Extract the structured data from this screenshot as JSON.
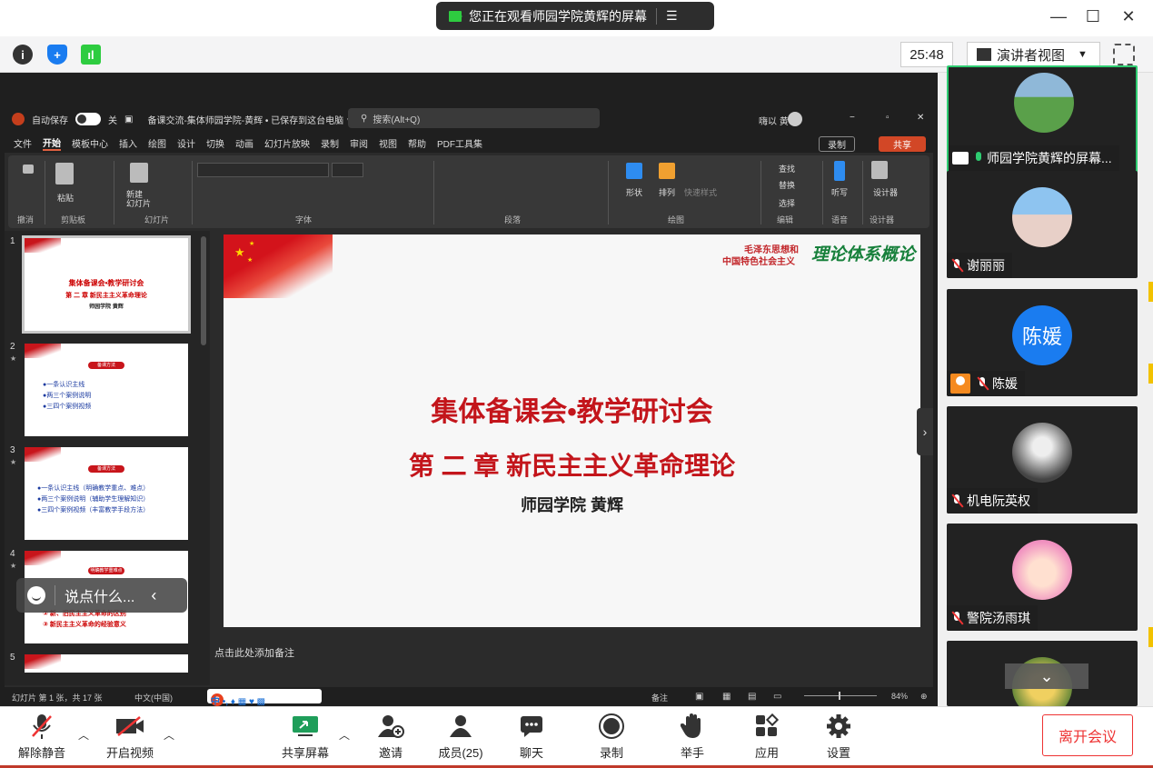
{
  "banner": {
    "text": "您正在观看师园学院黄辉的屏幕"
  },
  "window": {
    "minimize": "—",
    "maximize": "☐",
    "close": "✕"
  },
  "toolbar": {
    "timer": "25:48",
    "view_mode": "演讲者视图"
  },
  "ppt": {
    "autosave": "自动保存",
    "autosave_state": "关",
    "doc_title": "备课交流-集体师园学院-黄辉 • 已保存到这台电脑 ∨",
    "search_placeholder": "搜索(Alt+Q)",
    "user": "嗨以 黄",
    "menu": [
      "文件",
      "开始",
      "模板中心",
      "插入",
      "绘图",
      "设计",
      "切换",
      "动画",
      "幻灯片放映",
      "录制",
      "审阅",
      "视图",
      "帮助",
      "PDF工具集"
    ],
    "record_btn": "录制",
    "share_btn": "共享",
    "ribbon_groups": [
      "撤消",
      "剪贴板",
      "幻灯片",
      "字体",
      "段落",
      "绘图",
      "编辑",
      "语音",
      "设计器"
    ],
    "ribbon_labels": {
      "paste": "粘贴",
      "new_slide": "新建\n幻灯片",
      "shape": "形状",
      "arrange": "排列",
      "quick_style": "快速样式",
      "find": "查找",
      "replace": "替换",
      "select": "选择",
      "dictate": "听写",
      "designer": "设计器"
    },
    "thumbnails": [
      {
        "num": "1",
        "title": "集体备课会•教学研讨会",
        "sub": "第 二 章   新民主主义革命理论",
        "author": "师园学院 黄辉"
      },
      {
        "num": "2",
        "pill": "备课方法",
        "lines": [
          "●一条认识主线",
          "●两三个案例说明",
          "●三四个案例视频"
        ]
      },
      {
        "num": "3",
        "pill": "备课方法",
        "lines": [
          "●一条认识主线（明确教学重点、难点）",
          "●两三个案例说明（辅助学生理解知识）",
          "●三四个案例视频（丰富教学手段方法）"
        ]
      },
      {
        "num": "4",
        "pill": "明确教学重难点",
        "lines": [
          "② 新、旧民主主义革命的区别",
          "③ 新民主主义革命的经验意义"
        ]
      },
      {
        "num": "5"
      }
    ],
    "slide": {
      "brand_line1": "毛泽东思想和",
      "brand_line2": "中国特色社会主义",
      "brand_big": "理论体系概论",
      "title": "集体备课会•教学研讨会",
      "chapter": "第 二 章   新民主主义革命理论",
      "author": "师园学院 黄辉"
    },
    "notes_placeholder": "点击此处添加备注",
    "status": {
      "slide_count": "幻灯片 第 1 张，共 17 张",
      "language": "中文(中国)",
      "notes": "备注",
      "zoom": "84%"
    },
    "ime_text": "中 •, ♦ ▦ ♥ ▩"
  },
  "chat_float": {
    "placeholder": "说点什么..."
  },
  "participants": [
    {
      "name": "师园学院黄辉的屏幕...",
      "type": "photo",
      "status": "sharing"
    },
    {
      "name": "谢丽丽",
      "type": "photo",
      "status": "muted"
    },
    {
      "name": "陈媛",
      "type": "text",
      "initials": "陈媛",
      "status": "muted"
    },
    {
      "name": "机电阮英权",
      "type": "photo",
      "status": "muted"
    },
    {
      "name": "警院汤雨琪",
      "type": "photo",
      "status": "muted"
    },
    {
      "name": "",
      "type": "photo",
      "status": ""
    }
  ],
  "bottom": {
    "unmute": "解除静音",
    "video": "开启视频",
    "share": "共享屏幕",
    "invite": "邀请",
    "members": "成员(25)",
    "chat": "聊天",
    "record": "录制",
    "raise_hand": "举手",
    "apps": "应用",
    "settings": "设置",
    "leave": "离开会议"
  },
  "colors": {
    "accent_green": "#2ecc71",
    "leave_red": "#e33333",
    "slide_red": "#c3151b",
    "brand_green": "#17803b"
  }
}
